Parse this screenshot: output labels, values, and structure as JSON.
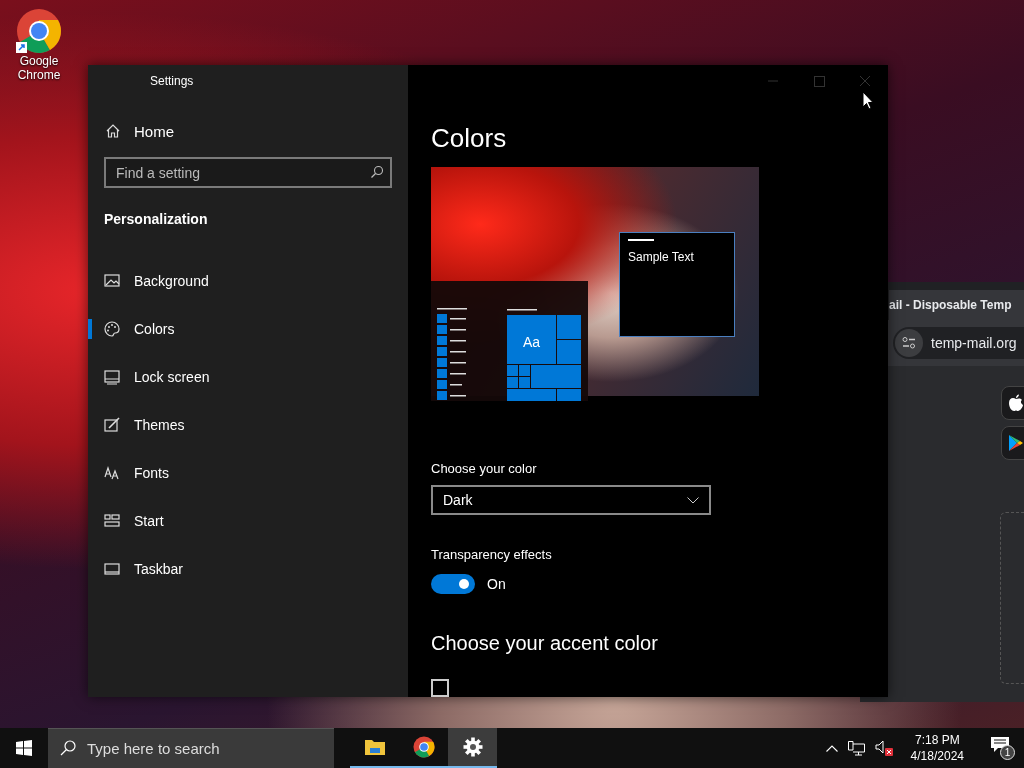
{
  "desktop": {
    "icons": [
      {
        "label": "Google Chrome"
      }
    ]
  },
  "settings": {
    "title": "Settings",
    "home": "Home",
    "search": {
      "placeholder": "Find a setting"
    },
    "section": "Personalization",
    "nav": [
      {
        "label": "Background",
        "selected": false
      },
      {
        "label": "Colors",
        "selected": true
      },
      {
        "label": "Lock screen",
        "selected": false
      },
      {
        "label": "Themes",
        "selected": false
      },
      {
        "label": "Fonts",
        "selected": false
      },
      {
        "label": "Start",
        "selected": false
      },
      {
        "label": "Taskbar",
        "selected": false
      }
    ],
    "page": {
      "title": "Colors",
      "preview": {
        "tile_label": "Aa",
        "sample_text": "Sample Text"
      },
      "color_mode": {
        "label": "Choose your color",
        "value": "Dark"
      },
      "transparency": {
        "label": "Transparency effects",
        "on": true,
        "state_text": "On"
      },
      "accent_heading": "Choose your accent color",
      "auto_accent": {
        "checked": false
      }
    }
  },
  "browser": {
    "tab_title": "ail - Disposable Temp",
    "address": "temp-mail.org"
  },
  "taskbar": {
    "search": {
      "placeholder": "Type here to search"
    },
    "apps": [
      {
        "selected": false
      },
      {
        "selected": false
      },
      {
        "selected": true
      }
    ],
    "volume": {
      "muted": true
    },
    "clock": {
      "time": "7:18 PM",
      "date": "4/18/2024"
    },
    "notifications": {
      "count": "1"
    }
  }
}
